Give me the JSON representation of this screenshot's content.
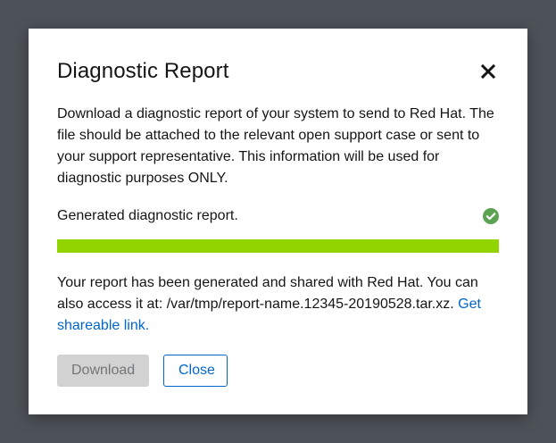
{
  "modal": {
    "title": "Diagnostic Report",
    "close_icon": "close-icon",
    "description": "Download a diagnostic report of your system to send to Red Hat. The file should be attached to the relevant open support case or sent to your support representative. This information will be used for diagnostic purposes ONLY.",
    "status": {
      "text": "Generated diagnostic report.",
      "icon": "check-circle-icon",
      "icon_color": "#3e8635"
    },
    "progress": {
      "percent": 100,
      "color": "#92d400"
    },
    "result": {
      "text": "Your report has been generated and shared with Red Hat. You can also access it at: /var/tmp/report-name.12345-20190528.tar.xz. ",
      "link_label": "Get shareable link."
    },
    "buttons": {
      "download_label": "Download",
      "close_label": "Close"
    }
  },
  "colors": {
    "backdrop": "#4d5258",
    "link": "#0066cc",
    "disabled_button_bg": "#d2d2d2"
  }
}
